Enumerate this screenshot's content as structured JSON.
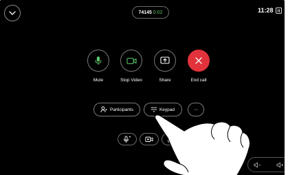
{
  "header": {
    "call_id": "74145",
    "call_timer": "0:02",
    "clock": "11:28"
  },
  "controls": [
    {
      "label": "Mute",
      "icon": "microphone-icon"
    },
    {
      "label": "Stop Video",
      "icon": "video-camera-icon"
    },
    {
      "label": "Share",
      "icon": "share-screen-icon"
    },
    {
      "label": "End call",
      "icon": "close-icon"
    }
  ],
  "chips": {
    "participants": "Participants",
    "keypad": "Keypad",
    "more": "···"
  },
  "colors": {
    "end_call": "#e2323b",
    "timer": "#5ec26a",
    "background": "#000000"
  }
}
